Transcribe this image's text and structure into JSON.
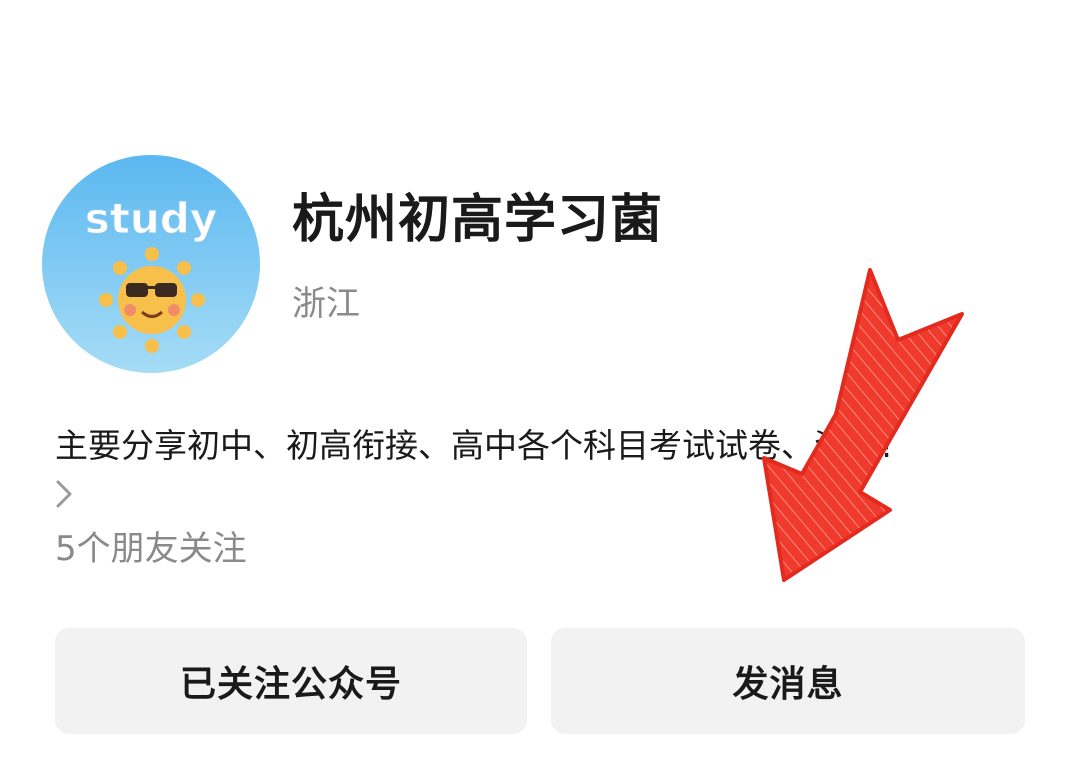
{
  "profile": {
    "avatar_text": "study",
    "name": "杭州初高学习菌",
    "region": "浙江",
    "description": "主要分享初中、初高衔接、高中各个科目考试试卷、资料!",
    "followers": "5个朋友关注"
  },
  "actions": {
    "follow_label": "已关注公众号",
    "message_label": "发消息"
  },
  "colors": {
    "avatar_bg_top": "#5bb8f0",
    "avatar_bg_bottom": "#a6dcf6",
    "sun": "#f4b73a",
    "arrow": "#f03a2e",
    "button_bg": "#f2f2f2"
  },
  "icons": {
    "chevron": "chevron-right-icon",
    "annotation": "red-arrow-annotation"
  }
}
